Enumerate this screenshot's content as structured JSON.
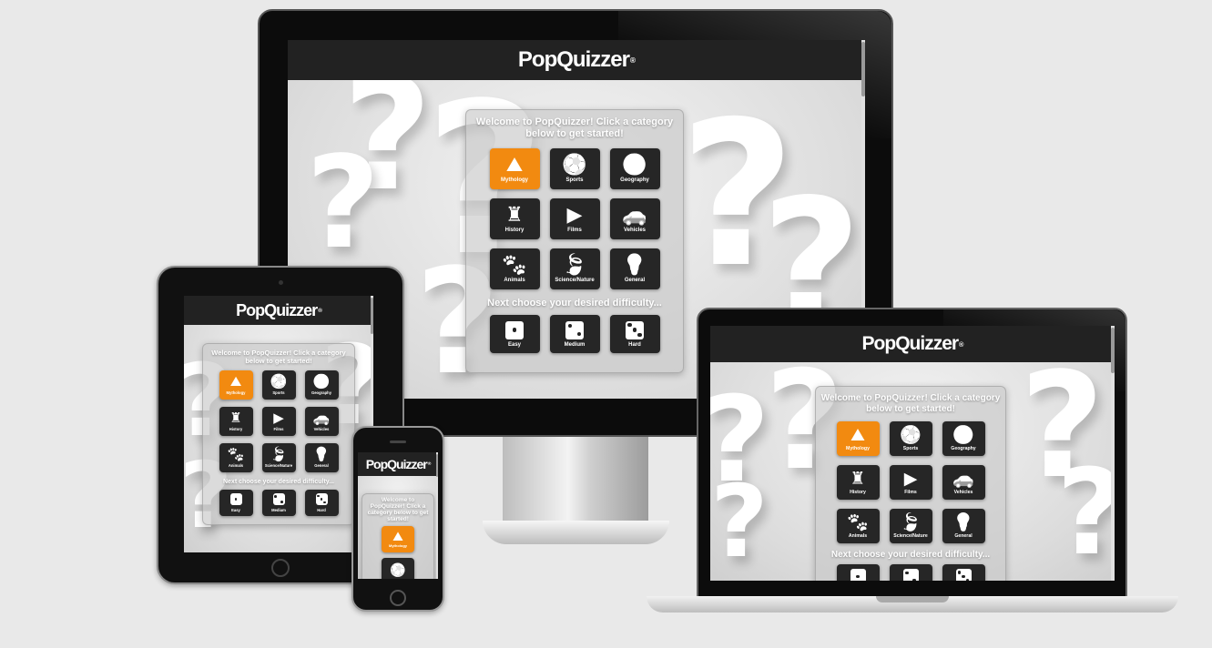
{
  "app": {
    "brand": "PopQuizzer",
    "brand_mark": "®",
    "welcome": "Welcome to PopQuizzer! Click a category below to get started!",
    "difficulty_prompt": "Next choose your desired difficulty...",
    "mobile_welcome": "Welcome to PopQuizzer! Click a category below to get started!"
  },
  "categories": [
    {
      "label": "Mythology",
      "icon": "wizard-hat-icon",
      "glyph": "⛰",
      "active": true
    },
    {
      "label": "Sports",
      "icon": "soccer-ball-icon",
      "glyph": "⚽",
      "active": false
    },
    {
      "label": "Geography",
      "icon": "globe-icon",
      "glyph": "🌍",
      "active": false
    },
    {
      "label": "History",
      "icon": "castle-icon",
      "glyph": "♜",
      "active": false
    },
    {
      "label": "Films",
      "icon": "video-camera-icon",
      "glyph": "▶",
      "active": false
    },
    {
      "label": "Vehicles",
      "icon": "car-icon",
      "glyph": "🚗",
      "active": false
    },
    {
      "label": "Animals",
      "icon": "paw-icon",
      "glyph": "🐾",
      "active": false
    },
    {
      "label": "Science/Nature",
      "icon": "leaf-icon",
      "glyph": "🍃",
      "active": false
    },
    {
      "label": "General",
      "icon": "lightbulb-icon",
      "glyph": "💡",
      "active": false
    }
  ],
  "difficulties": [
    {
      "label": "Easy",
      "icon": "die-one-icon",
      "pips": 1
    },
    {
      "label": "Medium",
      "icon": "die-two-icon",
      "pips": 2
    },
    {
      "label": "Hard",
      "icon": "die-three-icon",
      "pips": 3
    }
  ],
  "colors": {
    "background": "#e9e9e9",
    "header": "#222222",
    "tile": "#262626",
    "accent": "#f28a10"
  }
}
